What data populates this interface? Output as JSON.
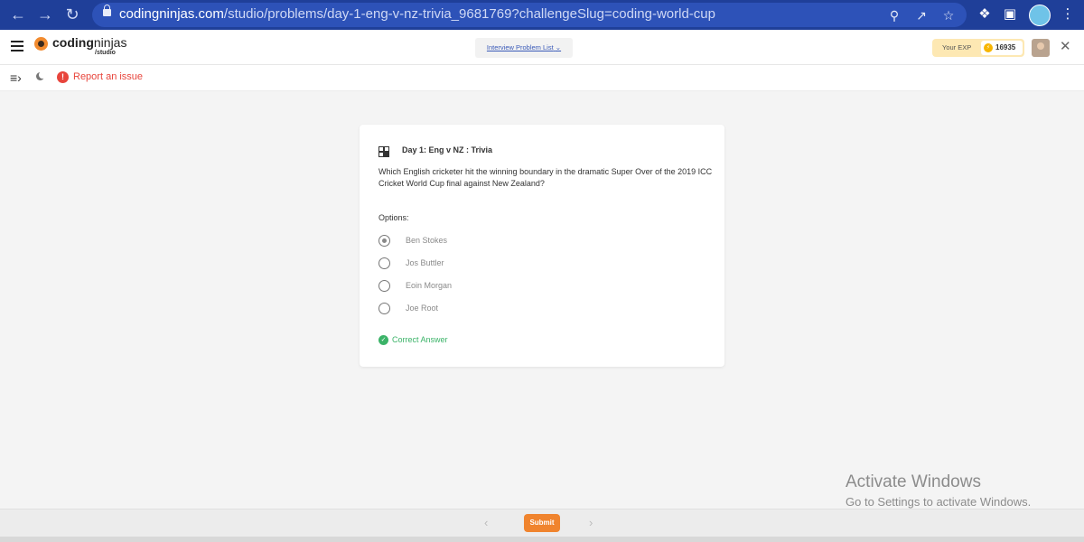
{
  "browser": {
    "url_domain": "codingninjas.com",
    "url_path": "/studio/problems/day-1-eng-v-nz-trivia_9681769?challengeSlug=coding-world-cup"
  },
  "header": {
    "logo_bold": "coding",
    "logo_light": "ninjas",
    "logo_sub": "/studio",
    "problem_list_label": "Interview Problem List",
    "exp_label": "Your EXP",
    "exp_value": "16935"
  },
  "toolbar": {
    "report_label": "Report an issue"
  },
  "quiz": {
    "title": "Day 1: Eng v NZ : Trivia",
    "question": "Which English cricketer hit the winning boundary in the dramatic Super Over of the 2019 ICC Cricket World Cup final against New Zealand?",
    "options_label": "Options:",
    "options": [
      {
        "label": "Ben Stokes",
        "selected": true
      },
      {
        "label": "Jos Buttler",
        "selected": false
      },
      {
        "label": "Eoin Morgan",
        "selected": false
      },
      {
        "label": "Joe Root",
        "selected": false
      }
    ],
    "result_text": "Correct Answer"
  },
  "watermark": {
    "title": "Activate Windows",
    "subtitle": "Go to Settings to activate Windows."
  },
  "footer": {
    "submit_label": "Submit"
  },
  "colors": {
    "brand_orange": "#f0842e",
    "chrome_blue": "#1f3f99",
    "success_green": "#3bb368",
    "alert_red": "#e8453c"
  }
}
